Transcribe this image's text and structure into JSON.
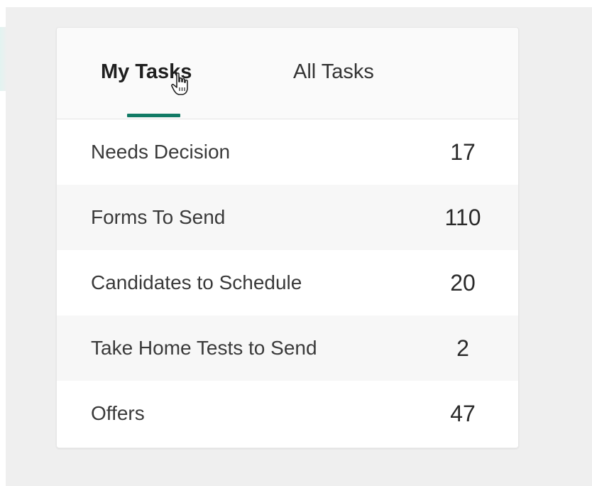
{
  "tabs": {
    "my_tasks": "My Tasks",
    "all_tasks": "All Tasks",
    "active": "my_tasks"
  },
  "tasks": [
    {
      "label": "Needs Decision",
      "count": "17"
    },
    {
      "label": "Forms To Send",
      "count": "110"
    },
    {
      "label": "Candidates to Schedule",
      "count": "20"
    },
    {
      "label": "Take Home Tests to Send",
      "count": "2"
    },
    {
      "label": "Offers",
      "count": "47"
    }
  ],
  "colors": {
    "accent": "#117a65",
    "background": "#efefef",
    "card": "#ffffff",
    "row_alt": "#f7f7f7"
  },
  "icons": {
    "cursor": "hand-pointer-icon"
  }
}
